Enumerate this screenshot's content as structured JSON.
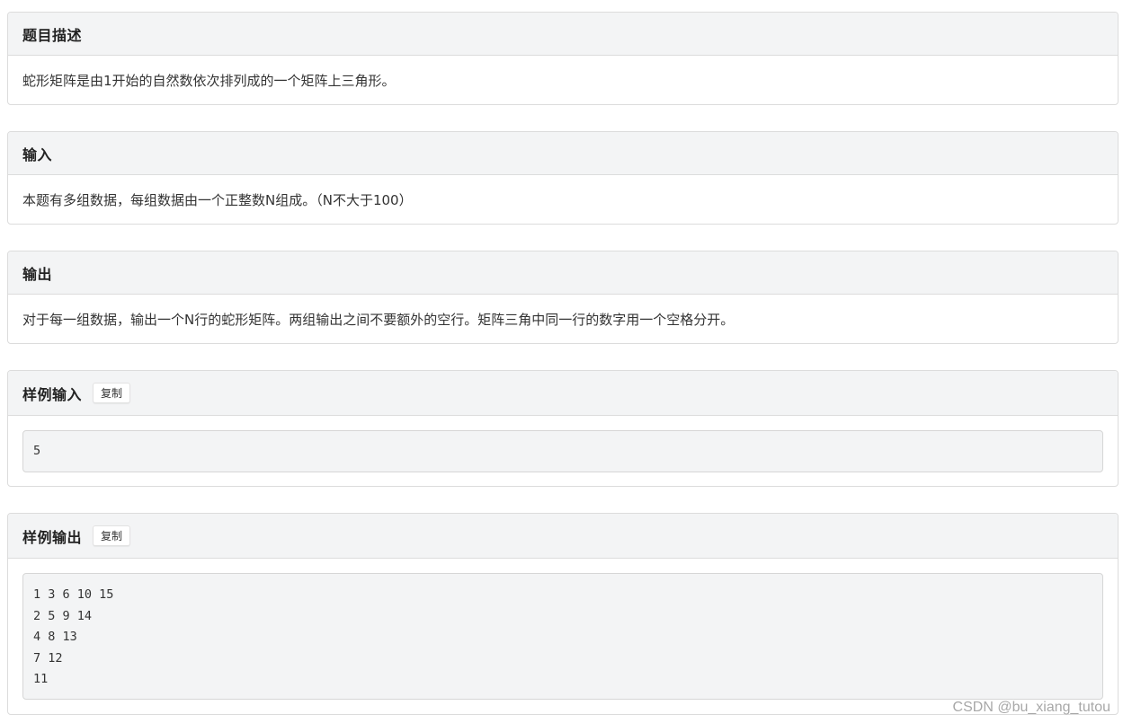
{
  "sections": {
    "description": {
      "title": "题目描述",
      "text": "蛇形矩阵是由1开始的自然数依次排列成的一个矩阵上三角形。"
    },
    "input": {
      "title": "输入",
      "text": "本题有多组数据，每组数据由一个正整数N组成。（N不大于100）"
    },
    "output": {
      "title": "输出",
      "text": "对于每一组数据，输出一个N行的蛇形矩阵。两组输出之间不要额外的空行。矩阵三角中同一行的数字用一个空格分开。"
    },
    "sample_input": {
      "title": "样例输入",
      "copy_label": "复制",
      "lines": [
        "5"
      ]
    },
    "sample_output": {
      "title": "样例输出",
      "copy_label": "复制",
      "lines": [
        "1 3 6 10 15",
        "2 5 9 14",
        "4 8 13",
        "7 12",
        "11"
      ]
    }
  },
  "watermark": "CSDN @bu_xiang_tutou"
}
